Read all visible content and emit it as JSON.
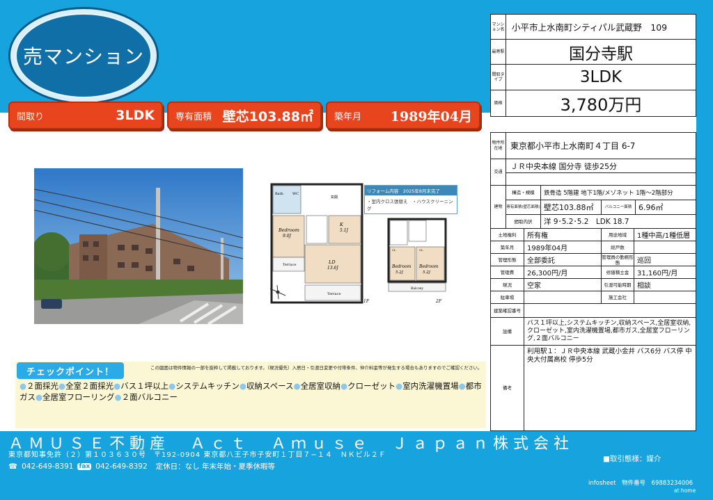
{
  "badge": {
    "label": "売マンション"
  },
  "pills": {
    "layout": {
      "label": "間取り",
      "value": "3LDK"
    },
    "area": {
      "label": "専有面積",
      "value": "壁芯103.88㎡"
    },
    "built": {
      "label": "築年月",
      "value": "1989年04月"
    }
  },
  "summary": {
    "name_key": "マンション名",
    "name": "小平市上水南町シティパル武蔵野　109",
    "station_key": "最寄駅",
    "station": "国分寺駅",
    "type_key": "間取タイプ",
    "type": "3LDK",
    "price_key": "価格",
    "price": "3,780万円"
  },
  "reform": {
    "title": "リフォーム内容　2025年8月末完了",
    "body": "・室内クロス張替え　・ハウスクリーニング"
  },
  "floorplan": {
    "bedroom1": "Bedroom",
    "bedroom1_size": "9.0J",
    "kitchen": "K",
    "kitchen_size": "5.1J",
    "ld": "LD",
    "ld_size": "13.6J",
    "bedroom2": "Bedroom",
    "bedroom2_size": "5.2J",
    "bedroom3": "Bedroom",
    "bedroom3_size": "5.2J",
    "terrace": "Terrace",
    "balcony": "Balcony",
    "floor1": "1F",
    "floor2": "2F",
    "bath": "Bath",
    "wc": "WC",
    "cl": "CL",
    "entrance": "玄関"
  },
  "disclaimer": "この図面は物件情報の一部を抜粋して掲載しております。（現況優先）入居日・引渡日変更や付帯条件、仲介料金等が発生する場合もありますのでご確認ください。",
  "check": {
    "title": "チェックポイント！",
    "points": [
      "２面採光",
      "全室２面採光",
      "バス１坪以上",
      "システムキッチン",
      "収納スペース",
      "全居室収納",
      "クローゼット",
      "室内洗濯機置場",
      "都市ガス",
      "全居室フローリング",
      "２面バルコニー"
    ]
  },
  "detail": {
    "address_key": "物件所在地",
    "address": "東京都小平市上水南町４丁目 6-7",
    "transport_key": "交通",
    "transport": "ＪＲ中央本線 国分寺 徒歩25分",
    "building_key": "建物",
    "structure_key": "構造・規模",
    "structure": "鉄骨造 5階建 地下1階/メゾネット 1階〜2階部分",
    "area_key": "専有面積(壁芯面積)",
    "area": "壁芯103.88㎡",
    "balcony_key": "バルコニー面積",
    "balcony": "6.96㎡",
    "rooms_key": "間取内訳",
    "rooms": "洋 9･5.2･5.2　LDK 18.7",
    "land_key": "土地権利",
    "land": "所有権",
    "zoning_key": "用途地域",
    "zoning": "1種中高/1種低層",
    "built_key": "築年月",
    "built": "1989年04月",
    "units_key": "総戸数",
    "units": "",
    "mgmt_key": "管理形態",
    "mgmt": "全部委託",
    "mgmt_style_key": "管理員の勤務形態",
    "mgmt_style": "巡回",
    "fee_key": "管理費",
    "fee": "26,300円/月",
    "reserve_key": "修繕積立金",
    "reserve": "31,160円/月",
    "status_key": "現況",
    "status": "空家",
    "handover_key": "引渡可能時期",
    "handover": "相談",
    "parking_key": "駐車場",
    "parking": "",
    "builder_key": "施工会社",
    "builder": "",
    "confirm_key": "建築確認番号",
    "confirm": "",
    "equip_key": "設備",
    "equip": "バス１坪以上,システムキッチン,収納スペース,全居室収納,クローゼット,室内洗濯機置場,都市ガス,全居室フローリング,２面バルコニー",
    "notes_key": "備考",
    "notes": "利用駅１：ＪＲ中央本線 武蔵小金井 バス6分 バス停 中央大付属高校 停歩5分"
  },
  "footer": {
    "company": "ＡＭＵＳＥ不動産　Ａｃｔ　Ａｍｕｓｅ　Ｊａｐａｎ株式会社",
    "license": "東京都知事免許（２）第１０３６３０号　〒192-0904 東京都八王子市子安町１丁目７−１４　ＮＫビル２Ｆ",
    "tel": "042-649-8391",
    "fax_label": "fax",
    "fax": "042-649-8392",
    "hours": "定休日：なし 年末年始・夏季休暇等",
    "deal": "■取引態様：媒介",
    "info": "infosheet　物件番号　69883234006",
    "at": "at home"
  }
}
